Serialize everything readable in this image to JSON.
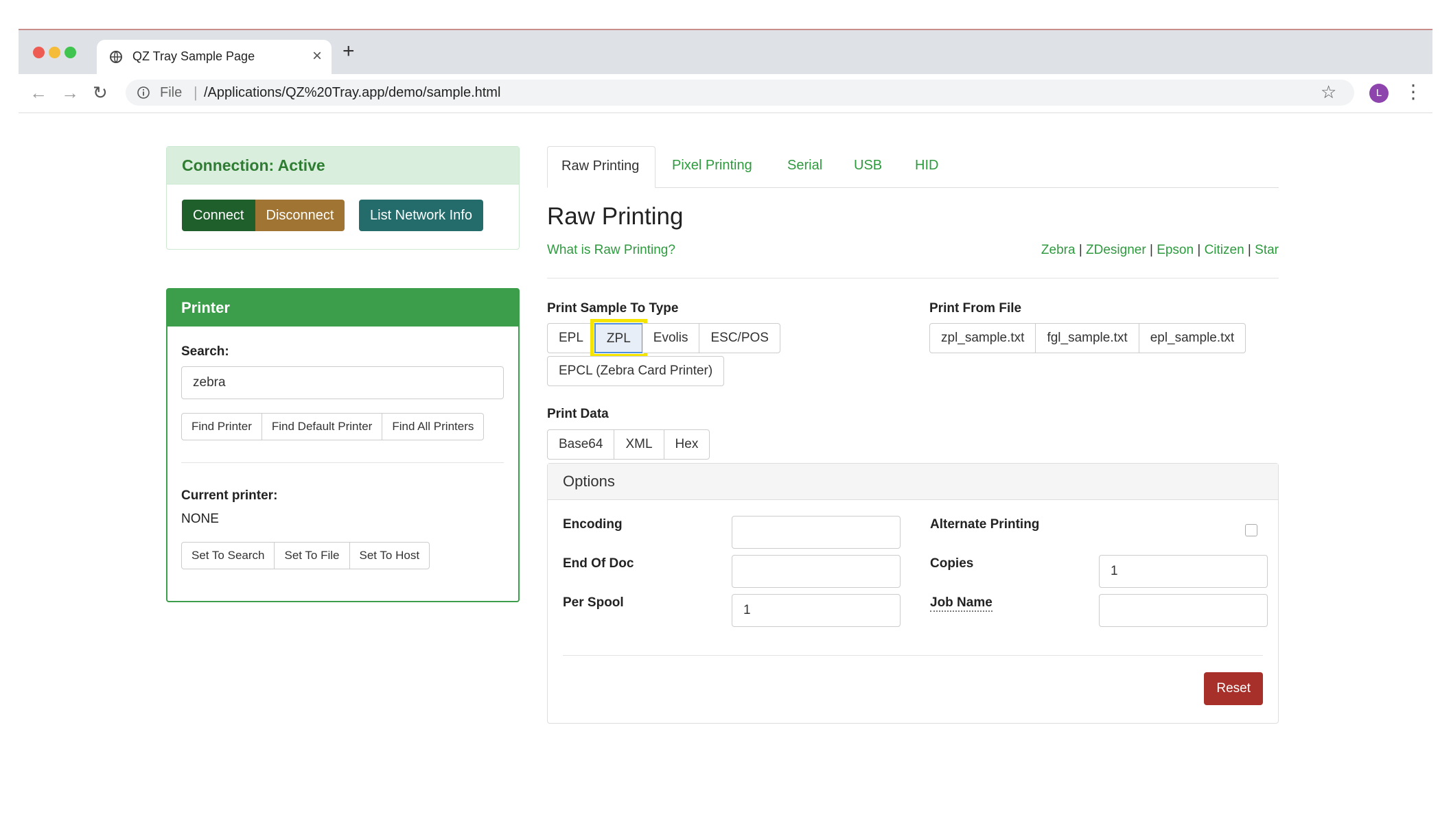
{
  "browser": {
    "tab_title": "QZ Tray Sample Page",
    "omnibox_scheme": "File",
    "omnibox_url": "/Applications/QZ%20Tray.app/demo/sample.html",
    "avatar_letter": "L"
  },
  "connection": {
    "header": "Connection: Active",
    "connect_label": "Connect",
    "disconnect_label": "Disconnect",
    "network_label": "List Network Info"
  },
  "printer": {
    "header": "Printer",
    "search_label": "Search:",
    "search_value": "zebra",
    "find_printer": "Find Printer",
    "find_default": "Find Default Printer",
    "find_all": "Find All Printers",
    "current_label": "Current printer:",
    "current_value": "NONE",
    "set_search": "Set To Search",
    "set_file": "Set To File",
    "set_host": "Set To Host"
  },
  "tabs": [
    "Raw Printing",
    "Pixel Printing",
    "Serial",
    "USB",
    "HID"
  ],
  "raw": {
    "title": "Raw Printing",
    "what_is": "What is Raw Printing?",
    "vendors": [
      "Zebra",
      "ZDesigner",
      "Epson",
      "Citizen",
      "Star"
    ],
    "vendor_sep": "|",
    "sample_type_label": "Print Sample To Type",
    "sample_types": [
      "EPL",
      "ZPL",
      "Evolis",
      "ESC/POS"
    ],
    "sample_type_extra": "EPCL (Zebra Card Printer)",
    "from_file_label": "Print From File",
    "files": [
      "zpl_sample.txt",
      "fgl_sample.txt",
      "epl_sample.txt"
    ],
    "data_label": "Print Data",
    "data_types": [
      "Base64",
      "XML",
      "Hex"
    ]
  },
  "options": {
    "header": "Options",
    "encoding_label": "Encoding",
    "encoding_value": "",
    "end_of_doc_label": "End Of Doc",
    "end_of_doc_value": "",
    "per_spool_label": "Per Spool",
    "per_spool_value": "1",
    "alternate_label": "Alternate Printing",
    "copies_label": "Copies",
    "copies_value": "1",
    "job_name_label": "Job Name",
    "job_name_value": "",
    "reset_label": "Reset"
  },
  "colors": {
    "accent_green": "#3c9d4b",
    "connect_bg": "#1f5f2c",
    "disconnect_bg": "#a07432",
    "network_bg": "#236c6b",
    "reset_bg": "#a8302b",
    "highlight": "#f5e400"
  }
}
